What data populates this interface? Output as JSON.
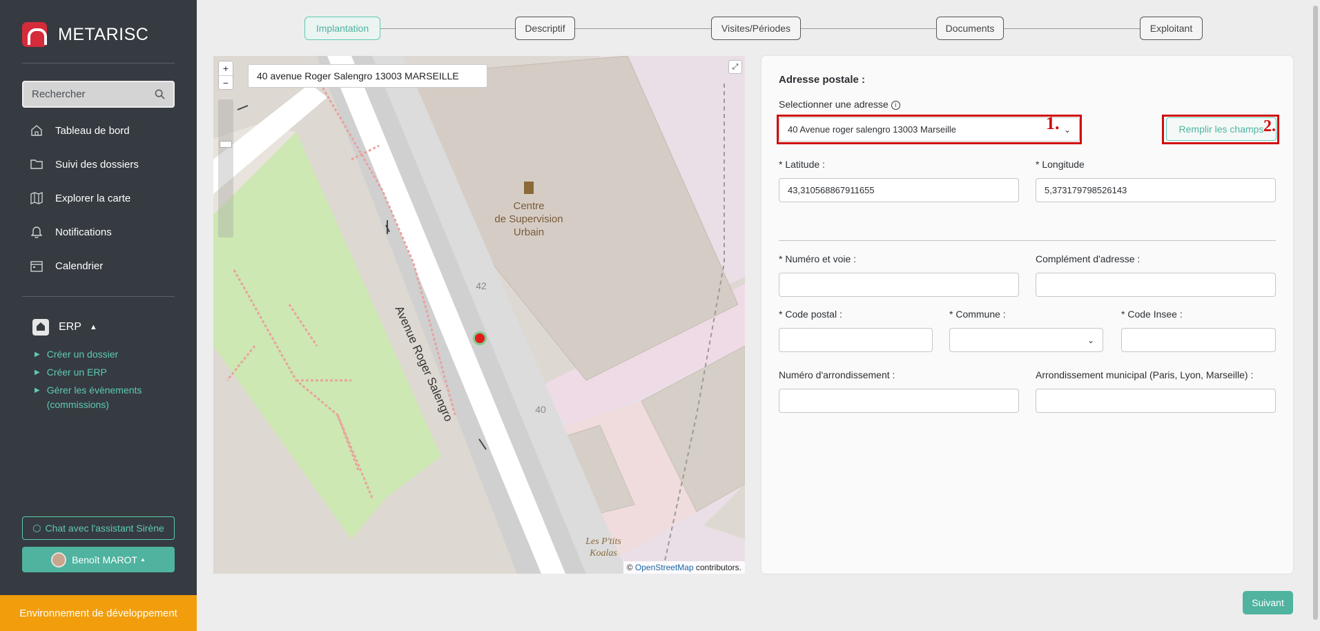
{
  "app": {
    "name": "METARISC"
  },
  "sidebar": {
    "search_placeholder": "Rechercher",
    "nav": [
      {
        "label": "Tableau de bord",
        "icon": "home-icon"
      },
      {
        "label": "Suivi des dossiers",
        "icon": "folder-icon"
      },
      {
        "label": "Explorer la carte",
        "icon": "map-icon"
      },
      {
        "label": "Notifications",
        "icon": "bell-icon"
      },
      {
        "label": "Calendrier",
        "icon": "calendar-icon"
      }
    ],
    "erp": {
      "label": "ERP",
      "items": [
        {
          "label": "Créer un dossier"
        },
        {
          "label": "Créer un ERP"
        },
        {
          "label": "Gérer les évènements\n(commissions)"
        }
      ]
    },
    "chat_label": "Chat avec l'assistant Sirène",
    "user_name": "Benoît MAROT",
    "env_label": "Environnement de développement"
  },
  "stepper": {
    "steps": [
      "Implantation",
      "Descriptif",
      "Visites/Périodes",
      "Documents",
      "Exploitant"
    ],
    "active_index": 0
  },
  "map": {
    "search_value": "40 avenue Roger Salengro 13003 MARSEILLE",
    "zoom_in": "+",
    "zoom_out": "−",
    "street_label": "Avenue Roger Salengro",
    "poi_name_1": "Centre",
    "poi_name_2": "de Supervision",
    "poi_name_3": "Urbain",
    "number_42": "42",
    "number_40": "40",
    "shop_1": "Les P'tits",
    "shop_2": "Koalas",
    "attribution_prefix": "©",
    "attribution_link": "OpenStreetMap",
    "attribution_suffix": "contributors."
  },
  "form": {
    "section_title": "Adresse postale :",
    "select_address_label": "Selectionner une adresse",
    "select_address_value": "40 Avenue roger salengro 13003 Marseille",
    "fill_button": "Remplir les champs",
    "annotation_1": "1.",
    "annotation_2": "2.",
    "latitude_label": "* Latitude :",
    "latitude_value": "43,310568867911655",
    "longitude_label": "* Longitude",
    "longitude_value": "5,373179798526143",
    "numero_voie_label": "* Numéro et voie :",
    "complement_label": "Complément d'adresse :",
    "code_postal_label": "* Code postal :",
    "commune_label": "* Commune :",
    "code_insee_label": "* Code Insee :",
    "num_arrondissement_label": "Numéro d'arrondissement :",
    "arrondissement_municipal_label": "Arrondissement municipal (Paris, Lyon, Marseille) :"
  },
  "next_button": "Suivant",
  "colors": {
    "accent": "#4fb3a0",
    "sidebar_bg": "#353b40",
    "brand": "#d52b3b",
    "env": "#f29e0c",
    "annotation": "#d10b0b"
  }
}
